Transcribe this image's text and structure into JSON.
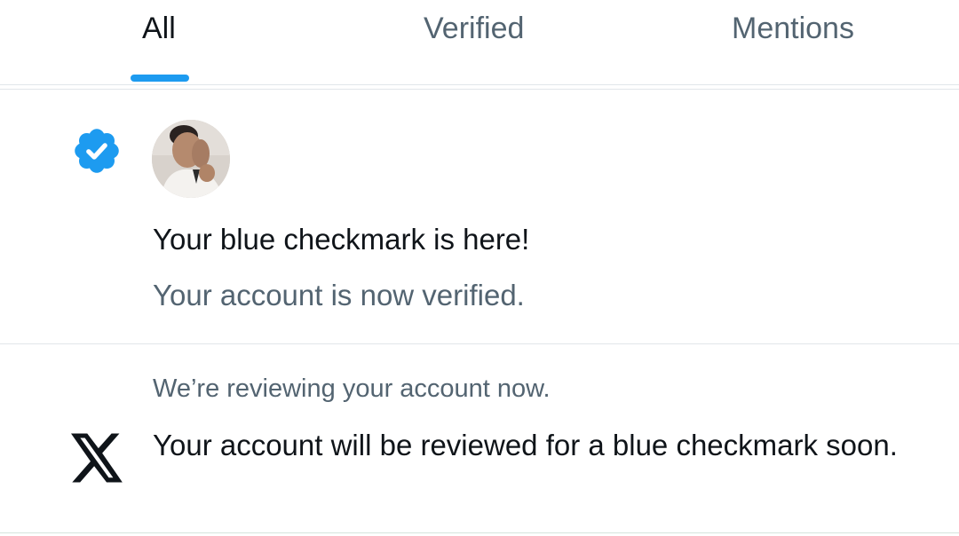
{
  "tabs": [
    {
      "label": "All",
      "active": true
    },
    {
      "label": "Verified",
      "active": false
    },
    {
      "label": "Mentions",
      "active": false
    }
  ],
  "colors": {
    "accent": "#1d9bf0",
    "text_primary": "#0f1419",
    "text_secondary": "#536471",
    "divider": "#e1e6ea"
  },
  "notifications": [
    {
      "icon": "verified-badge-icon",
      "avatar": "user-avatar",
      "title": "Your blue checkmark is here!",
      "subtitle": "Your account is now verified."
    },
    {
      "icon": "x-logo-icon",
      "header": "We’re reviewing your account now.",
      "body": "Your account will be reviewed for a blue checkmark soon."
    }
  ]
}
